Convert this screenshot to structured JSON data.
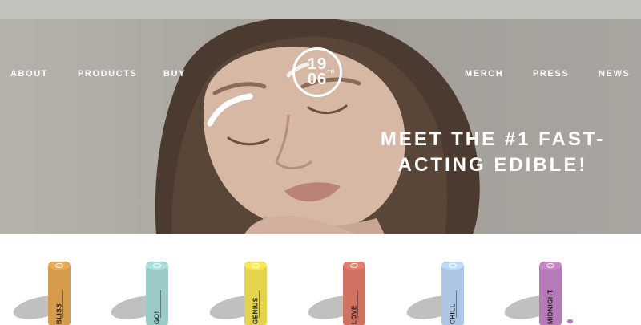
{
  "nav": {
    "left": [
      "ABOUT",
      "PRODUCTS",
      "BUY"
    ],
    "right": [
      "MERCH",
      "PRESS",
      "NEWS"
    ]
  },
  "logo": {
    "line1": "19",
    "line2": "06",
    "tm": "TM"
  },
  "hero": {
    "headline_line1": "MEET THE #1 FAST-",
    "headline_line2": "ACTING EDIBLE!"
  },
  "products": [
    {
      "name": "BLISS",
      "color": "#d69b4d"
    },
    {
      "name": "GO!",
      "color": "#9bcbc8"
    },
    {
      "name": "GENIUS",
      "color": "#e4d34c"
    },
    {
      "name": "LOVE",
      "color": "#d07262"
    },
    {
      "name": "CHILL",
      "color": "#aec6e6"
    },
    {
      "name": "MIDNIGHT",
      "color": "#b77ab8"
    }
  ]
}
